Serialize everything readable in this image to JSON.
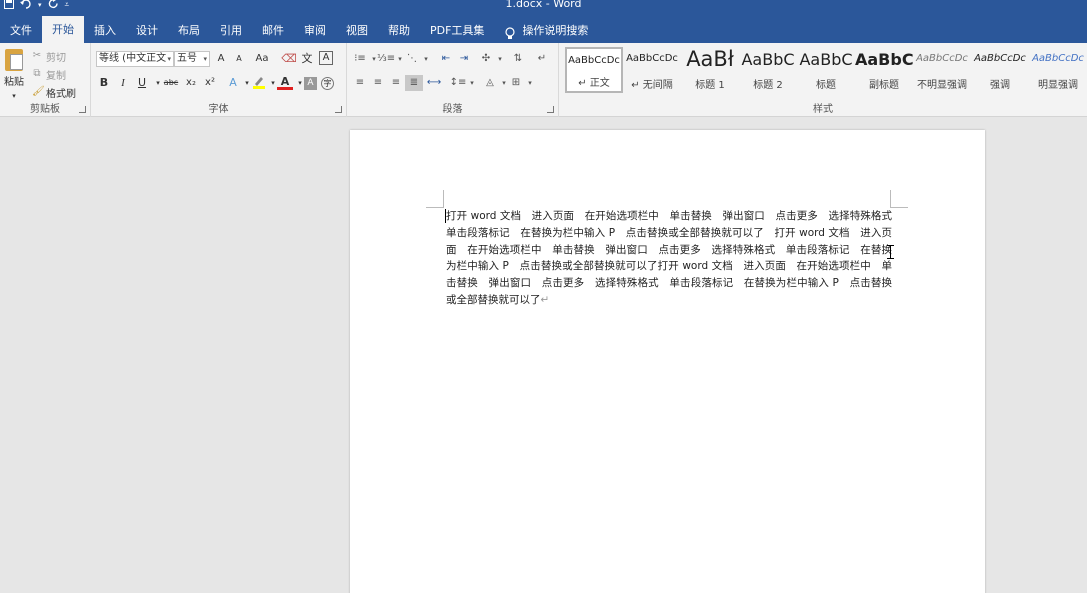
{
  "titlebar": {
    "title": "1.docx  -  Word"
  },
  "quick_access": {
    "save_icon": "save-icon",
    "undo_icon": "undo-icon",
    "redo_icon": "redo-icon",
    "customize_icon": "customize-icon"
  },
  "tabs": [
    {
      "label": "文件"
    },
    {
      "label": "开始"
    },
    {
      "label": "插入"
    },
    {
      "label": "设计"
    },
    {
      "label": "布局"
    },
    {
      "label": "引用"
    },
    {
      "label": "邮件"
    },
    {
      "label": "审阅"
    },
    {
      "label": "视图"
    },
    {
      "label": "帮助"
    },
    {
      "label": "PDF工具集"
    },
    {
      "label": "操作说明搜索"
    }
  ],
  "ribbon": {
    "clipboard": {
      "label": "剪贴板",
      "paste": "粘贴",
      "cut": "剪切",
      "copy": "复制",
      "format_painter": "格式刷"
    },
    "font": {
      "label": "字体",
      "font_name": "等线 (中文正文",
      "font_size": "五号",
      "bold": "B",
      "italic": "I",
      "underline": "U",
      "strike": "abc",
      "subscript": "x₂",
      "superscript": "x²",
      "grow": "A",
      "shrink": "A",
      "case": "Aa",
      "font_color": "A"
    },
    "paragraph": {
      "label": "段落"
    },
    "styles": {
      "label": "样式",
      "items": [
        {
          "preview": "AaBbCcDc",
          "name": "↵ 正文"
        },
        {
          "preview": "AaBbCcDc",
          "name": "↵ 无间隔"
        },
        {
          "preview": "AaBł",
          "name": "标题 1"
        },
        {
          "preview": "AaBbC",
          "name": "标题 2"
        },
        {
          "preview": "AaBbC",
          "name": "标题"
        },
        {
          "preview": "AaBbC",
          "name": "副标题"
        },
        {
          "preview": "AaBbCcDc",
          "name": "不明显强调"
        },
        {
          "preview": "AaBbCcDc",
          "name": "强调"
        },
        {
          "preview": "AaBbCcDc",
          "name": "明显强调"
        }
      ]
    }
  },
  "document": {
    "text": "打开 word 文档　进入页面　在开始选项栏中　单击替换　弹出窗口　点击更多　选择特殊格式　单击段落标记　在替换为栏中输入 P　点击替换或全部替换就可以了　打开 word 文档　进入页面　在开始选项栏中　单击替换　弹出窗口　点击更多　选择特殊格式　单击段落标记　在替换为栏中输入 P　点击替换或全部替换就可以了打开 word 文档　进入页面　在开始选项栏中　单击替换　弹出窗口　点击更多　选择特殊格式　单击段落标记　在替换为栏中输入 P　点击替换或全部替换就可以了",
    "paragraph_mark": "↵"
  }
}
